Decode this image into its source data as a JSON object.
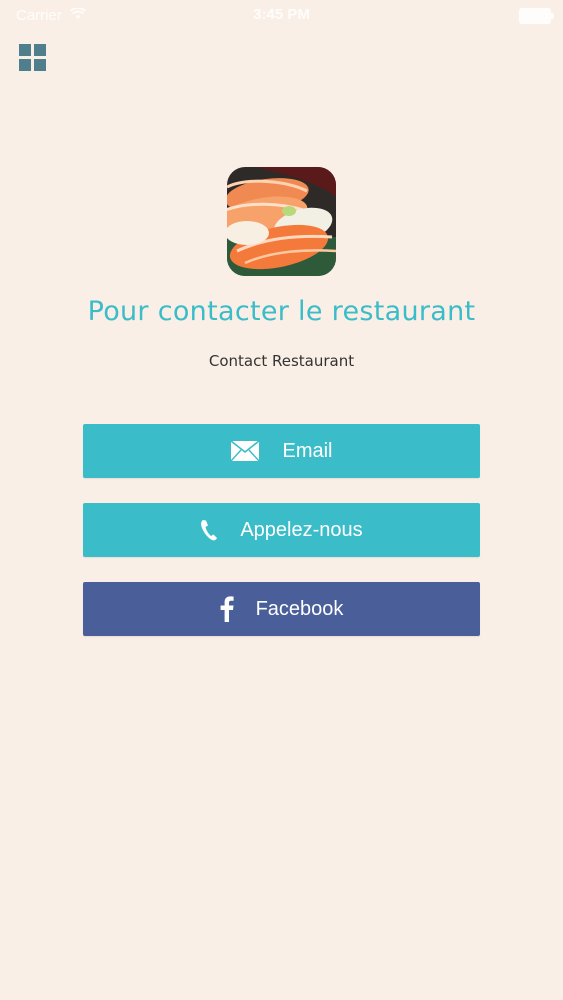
{
  "status_bar": {
    "carrier": "Carrier",
    "time": "3:45 PM"
  },
  "header": {
    "menu_icon": "grid-menu-icon"
  },
  "restaurant": {
    "title": "Pour contacter le restaurant",
    "subtitle": "Contact Restaurant"
  },
  "buttons": [
    {
      "label": "Email",
      "icon": "envelope-icon"
    },
    {
      "label": "Appelez-nous",
      "icon": "phone-icon"
    },
    {
      "label": "Facebook",
      "icon": "facebook-icon"
    }
  ],
  "colors": {
    "background": "#faefe6",
    "accent": "#3bbcc9",
    "facebook": "#4a5f9a"
  }
}
